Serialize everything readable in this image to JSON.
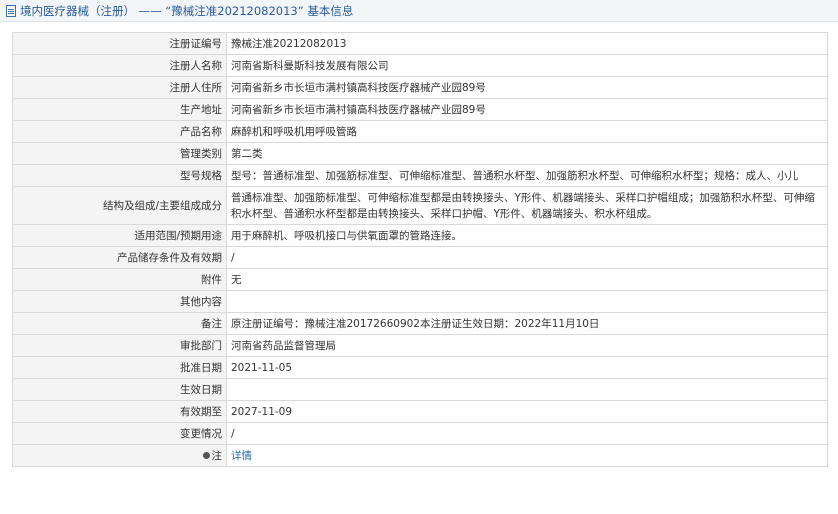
{
  "header": {
    "title": "境内医疗器械（注册） —— “豫械注准20212082013” 基本信息"
  },
  "rows": [
    {
      "label": "注册证编号",
      "value": "豫械注准20212082013"
    },
    {
      "label": "注册人名称",
      "value": "河南省斯科曼斯科技发展有限公司"
    },
    {
      "label": "注册人住所",
      "value": "河南省新乡市长垣市满村镇高科技医疗器械产业园89号"
    },
    {
      "label": "生产地址",
      "value": "河南省新乡市长垣市满村镇高科技医疗器械产业园89号"
    },
    {
      "label": "产品名称",
      "value": "麻醉机和呼吸机用呼吸管路"
    },
    {
      "label": "管理类别",
      "value": "第二类"
    },
    {
      "label": "型号规格",
      "value": "型号：普通标准型、加强筋标准型、可伸缩标准型、普通积水杯型、加强筋积水杯型、可伸缩积水杯型；规格：成人、小儿"
    },
    {
      "label": "结构及组成/主要组成成分",
      "value": "普通标准型、加强筋标准型、可伸缩标准型都是由转换接头、Y形件、机器端接头、采样口护帽组成；加强筋积水杯型、可伸缩积水杯型、普通积水杯型都是由转换接头、采样口护帽、Y形件、机器端接头、积水杯组成。"
    },
    {
      "label": "适用范围/预期用途",
      "value": "用于麻醉机、呼吸机接口与供氧面罩的管路连接。"
    },
    {
      "label": "产品储存条件及有效期",
      "value": "/"
    },
    {
      "label": "附件",
      "value": "无"
    },
    {
      "label": "其他内容",
      "value": ""
    },
    {
      "label": "备注",
      "value": "原注册证编号：豫械注准20172660902本注册证生效日期：2022年11月10日"
    },
    {
      "label": "审批部门",
      "value": "河南省药品监督管理局"
    },
    {
      "label": "批准日期",
      "value": "2021-11-05"
    },
    {
      "label": "生效日期",
      "value": ""
    },
    {
      "label": "有效期至",
      "value": "2027-11-09"
    },
    {
      "label": "变更情况",
      "value": "/"
    }
  ],
  "note_row": {
    "label": "注",
    "icon": "pin-icon",
    "link_text": "详情"
  }
}
